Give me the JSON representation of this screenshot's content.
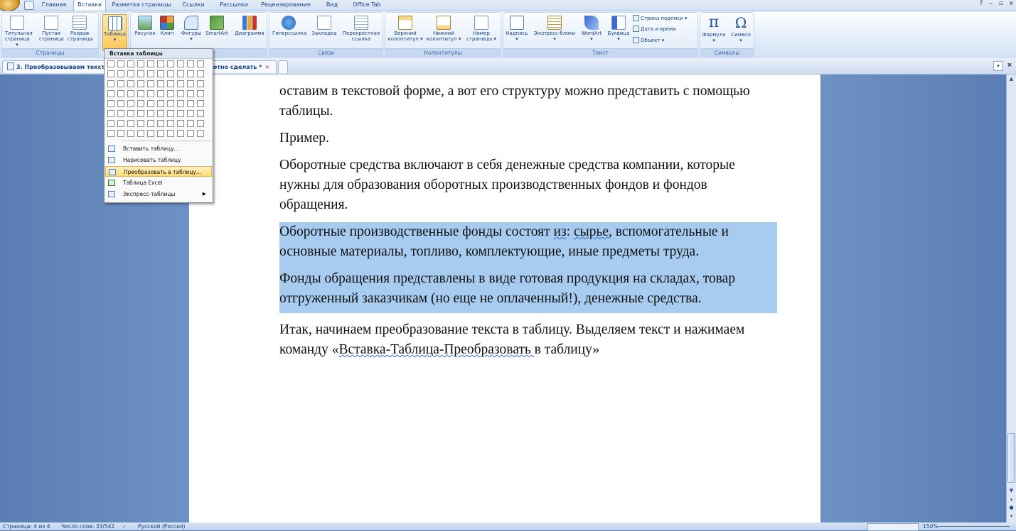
{
  "tabs": [
    "Главная",
    "Вставка",
    "Разметка страницы",
    "Ссылки",
    "Рассылки",
    "Рецензирование",
    "Вид",
    "Office Tab"
  ],
  "window_controls": [
    "?",
    "–",
    "▫",
    "x"
  ],
  "groups": {
    "pages": {
      "title": "Страницы",
      "buttons": [
        "Титульная\nстраница ▾",
        "Пустая\nстраница",
        "Разрыв\nстраницы"
      ]
    },
    "tables": {
      "button": "Таблица\n▾"
    },
    "illustrations": {
      "title": "Иллюстрации",
      "title_visible": "ии",
      "buttons": [
        "Рисунок",
        "Клип",
        "Фигуры\n▾",
        "SmartArt",
        "Диаграмма"
      ]
    },
    "links": {
      "title": "Связи",
      "buttons": [
        "Гиперссылка",
        "Закладка",
        "Перекрестная\nссылка"
      ]
    },
    "headers": {
      "title": "Колонтитулы",
      "buttons": [
        "Верхний\nколонтитул ▾",
        "Нижний\nколонтитул ▾",
        "Номер\nстраницы ▾"
      ]
    },
    "text": {
      "title": "Текст",
      "buttons": [
        "Надпись\n▾",
        "Экспресс-блоки\n▾",
        "WordArt\n▾",
        "Буквица\n▾"
      ],
      "small": [
        "Строка подписи ▾",
        "Дата и время",
        "Объект ▾"
      ]
    },
    "symbols": {
      "title": "Символы",
      "buttons": [
        "Формула\n▾",
        "Символ\n▾"
      ]
    }
  },
  "doc_tabs": {
    "first": "3. Преобразовываем текст",
    "second": "лотно сделать *",
    "close": "×"
  },
  "table_menu": {
    "header": "Вставка таблицы",
    "items": [
      "Вставить таблицу...",
      "Нарисовать таблицу",
      "Преобразовать в таблицу...",
      "Таблица Excel",
      "Экспресс-таблицы"
    ]
  },
  "document": {
    "p1": "оставим в текстовой форме, а вот его структуру можно представить с помощью таблицы.",
    "p2": "Пример.",
    "p3": "Оборотные средства включают в себя денежные средства компании, которые нужны для образования оборотных производственных фондов и фондов обращения.",
    "p4_a": "Оборотные производственные фонды состоят ",
    "p4_b": "из",
    "p4_c": ": ",
    "p4_d": "сырье",
    "p4_e": ", вспомогательные и основные материалы, топливо, комплектующие, иные предметы труда.",
    "p5": "Фонды обращения представлены в виде готовая продукция на складах, товар отгруженный заказчикам (но еще не оплаченный!), денежные средства.",
    "p6_a": "Итак, начинаем преобразование текста в таблицу. Выделяем текст и нажимаем команду «",
    "p6_b": "Вставка-Таблица-Преобразовать ",
    "p6_c": " в таблицу»"
  },
  "status": {
    "page": "Страница: 4 из 4",
    "words": "Число слов: 33/542",
    "language": "Русский (Россия)",
    "zoom": "150%"
  },
  "colors": {
    "selection": "#a8ccf0",
    "ribbon_accent": "#15428b",
    "pressed": "#fcc75c"
  }
}
